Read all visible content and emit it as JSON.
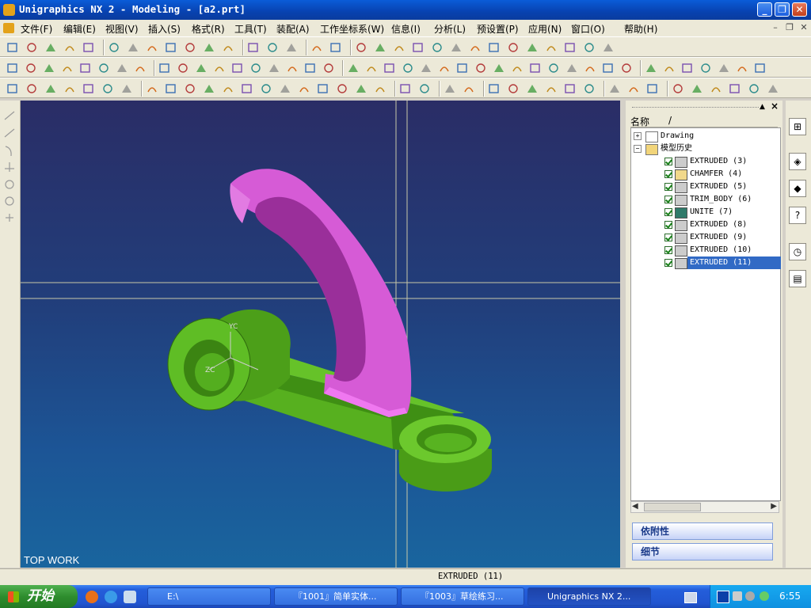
{
  "window": {
    "title": "Unigraphics NX 2 - Modeling - [a2.prt]",
    "controls": {
      "minimize": "_",
      "maximize": "❐",
      "close": "✕"
    }
  },
  "menu": {
    "items": [
      "文件(F)",
      "编辑(E)",
      "视图(V)",
      "插入(S)",
      "格式(R)",
      "工具(T)",
      "装配(A)",
      "工作坐标系(W)",
      "信息(I)",
      "分析(L)",
      "预设置(P)",
      "应用(N)",
      "窗口(O)",
      "帮助(H)"
    ],
    "mdi_controls": [
      "–",
      "❐",
      "✕"
    ]
  },
  "toolbars": {
    "row1_icons": [
      "new-icon",
      "open-icon",
      "save-icon",
      "cut-icon",
      "paint-icon",
      "transform-icon",
      "orient-icon",
      "shade-cube-icon",
      "render-icon",
      "wireframe-cube-icon",
      "wcs-icon",
      "view-cube-icon",
      "view-cube-2-icon",
      "sketch-icon",
      "snap-icon",
      "select-icon",
      "block-icon",
      "cylinder-icon",
      "cone-icon",
      "hole-icon",
      "pad-icon",
      "trim-icon",
      "pdf-icon",
      "layer-icon",
      "tool-icon",
      "gear-icon",
      "green-ball-icon",
      "display-icon",
      "clock-icon",
      "measure-icon",
      "tree-icon"
    ],
    "row2_icons": [
      "point-icon",
      "curve-icon",
      "spline-icon",
      "plus-icon",
      "line-icon",
      "arc-icon",
      "rect-icon",
      "circle-icon",
      "circle2-icon",
      "shape1-icon",
      "shape2-icon",
      "shape3-icon",
      "shape4-icon",
      "shape5-icon",
      "shape6-icon",
      "shape7-icon",
      "shape8-icon",
      "shape9-icon",
      "shape10-icon",
      "shape11-icon",
      "shape12-icon",
      "shape13-icon",
      "shape14-icon",
      "shape15-icon",
      "shape16-icon",
      "shape17-icon",
      "shape18-icon",
      "shape19-icon",
      "shape20-icon",
      "shape21-icon",
      "shape22-icon",
      "shape23-icon",
      "shape24-icon",
      "shape25-icon",
      "shape26-icon",
      "shape27-icon",
      "shape28-icon",
      "shape29-icon",
      "shape30-icon",
      "shape31-icon",
      "shape32-icon"
    ],
    "row3_icons": [
      "feat1-icon",
      "feat2-icon",
      "feat3-icon",
      "feat4-icon",
      "feat5-icon",
      "feat6-icon",
      "feat7-icon",
      "feat8-icon",
      "feat9-icon",
      "feat10-icon",
      "feat11-icon",
      "feat12-icon",
      "feat13-icon",
      "feat14-icon",
      "feat15-icon",
      "feat16-icon",
      "feat17-icon",
      "feat18-icon",
      "feat19-icon",
      "feat20-icon",
      "feat21-icon",
      "feat22-icon",
      "feat23-icon",
      "feat24-icon",
      "feat25-icon",
      "feat26-icon",
      "feat27-icon",
      "feat28-icon",
      "feat29-icon",
      "feat30-icon",
      "feat31-icon",
      "feat32-icon",
      "feat33-icon",
      "feat34-icon",
      "feat35-icon",
      "feat36-icon",
      "feat37-icon",
      "feat38-icon",
      "feat39-icon"
    ]
  },
  "viewport": {
    "view_label": "TOP WORK",
    "axis_labels": {
      "y": "YC",
      "z": "ZC"
    },
    "colors": {
      "base_part": "#4ea51a",
      "arc_part": "#d65bd6",
      "crosshair": "#c8c8a8"
    }
  },
  "navigator": {
    "column_header": "名称",
    "sort_indicator": "/",
    "tree": [
      {
        "label": "Drawing",
        "level": 0,
        "icon": "drawing-icon"
      },
      {
        "label": "模型历史",
        "level": 0,
        "icon": "folder-icon"
      },
      {
        "label": "EXTRUDED (3)",
        "level": 1,
        "icon": "extrude-icon"
      },
      {
        "label": "CHAMFER (4)",
        "level": 1,
        "icon": "chamfer-icon"
      },
      {
        "label": "EXTRUDED (5)",
        "level": 1,
        "icon": "extrude-icon"
      },
      {
        "label": "TRIM_BODY (6)",
        "level": 1,
        "icon": "extrude-icon"
      },
      {
        "label": "UNITE (7)",
        "level": 1,
        "icon": "unite-icon"
      },
      {
        "label": "EXTRUDED (8)",
        "level": 1,
        "icon": "extrude-icon"
      },
      {
        "label": "EXTRUDED (9)",
        "level": 1,
        "icon": "extrude-icon"
      },
      {
        "label": "EXTRUDED (10)",
        "level": 1,
        "icon": "extrude-icon"
      },
      {
        "label": "EXTRUDED (11)",
        "level": 1,
        "icon": "extrude-icon",
        "selected": true
      }
    ],
    "panels": [
      "依附性",
      "细节"
    ],
    "panel_close": "×"
  },
  "status": {
    "text": "EXTRUDED (11)"
  },
  "taskbar": {
    "start_label": "开始",
    "tasks": [
      {
        "label": "E:\\",
        "active": false
      },
      {
        "label": "『1001』简单实体...",
        "active": false
      },
      {
        "label": "『1003』草绘练习...",
        "active": false
      },
      {
        "label": "Unigraphics NX 2...",
        "active": true
      }
    ],
    "clock": "6:55"
  }
}
